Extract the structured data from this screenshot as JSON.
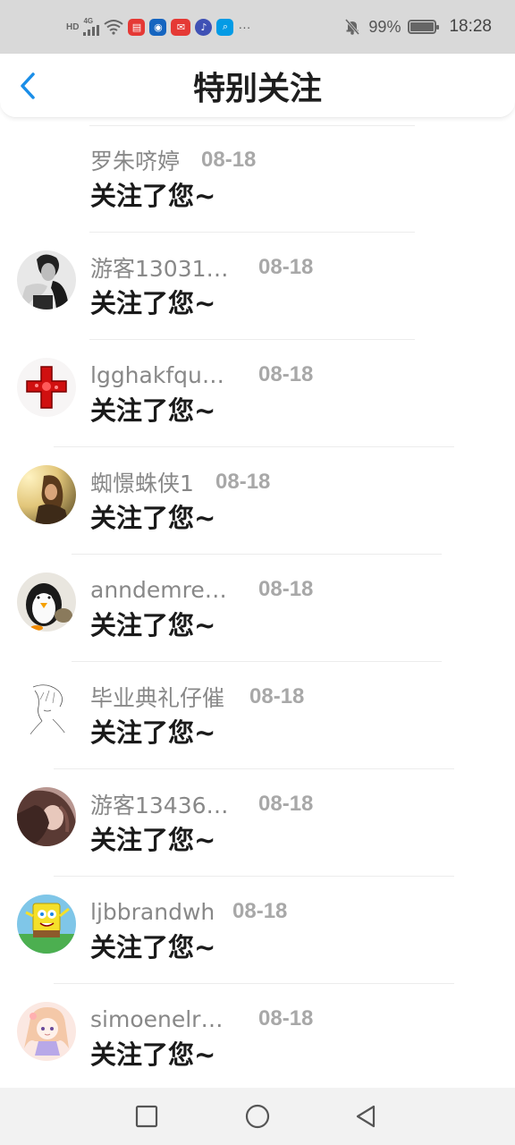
{
  "status_bar": {
    "hd": "HD",
    "network": "4G",
    "more": "···",
    "battery_percent": "99%",
    "battery_level": 0.99,
    "time": "18:28",
    "icons": [
      "signal-icon",
      "wifi-icon",
      "app-red-icon",
      "lightbulb-icon",
      "app-mail-icon",
      "music-icon",
      "search-app-icon",
      "bell-mute-icon",
      "battery-icon"
    ]
  },
  "header": {
    "title": "特别关注",
    "back_icon": "chevron-left-icon",
    "accent": "#1a8ee8"
  },
  "list": {
    "items": [
      {
        "name": "罗朱哜婷",
        "date": "08-18",
        "message": "关注了您~",
        "avatar": "none"
      },
      {
        "name": "游客13031…",
        "date": "08-18",
        "message": "关注了您~",
        "avatar": "bw-portrait"
      },
      {
        "name": "lgghakfqu…",
        "date": "08-18",
        "message": "关注了您~",
        "avatar": "red-cross"
      },
      {
        "name": "蜘憬蛛侠1",
        "date": "08-18",
        "message": "关注了您~",
        "avatar": "sunset-girl"
      },
      {
        "name": "anndemre…",
        "date": "08-18",
        "message": "关注了您~",
        "avatar": "penguin"
      },
      {
        "name": "毕业典礼仔催",
        "date": "08-18",
        "message": "关注了您~",
        "avatar": "sketch"
      },
      {
        "name": "游客13436…",
        "date": "08-18",
        "message": "关注了您~",
        "avatar": "hair-portrait"
      },
      {
        "name": "ljbbrandwh",
        "date": "08-18",
        "message": "关注了您~",
        "avatar": "spongebob"
      },
      {
        "name": "simoenelr…",
        "date": "08-18",
        "message": "关注了您~",
        "avatar": "anime-girl"
      }
    ]
  },
  "nav_bar": {
    "icons": [
      "recent-apps-icon",
      "home-icon",
      "back-icon"
    ]
  }
}
